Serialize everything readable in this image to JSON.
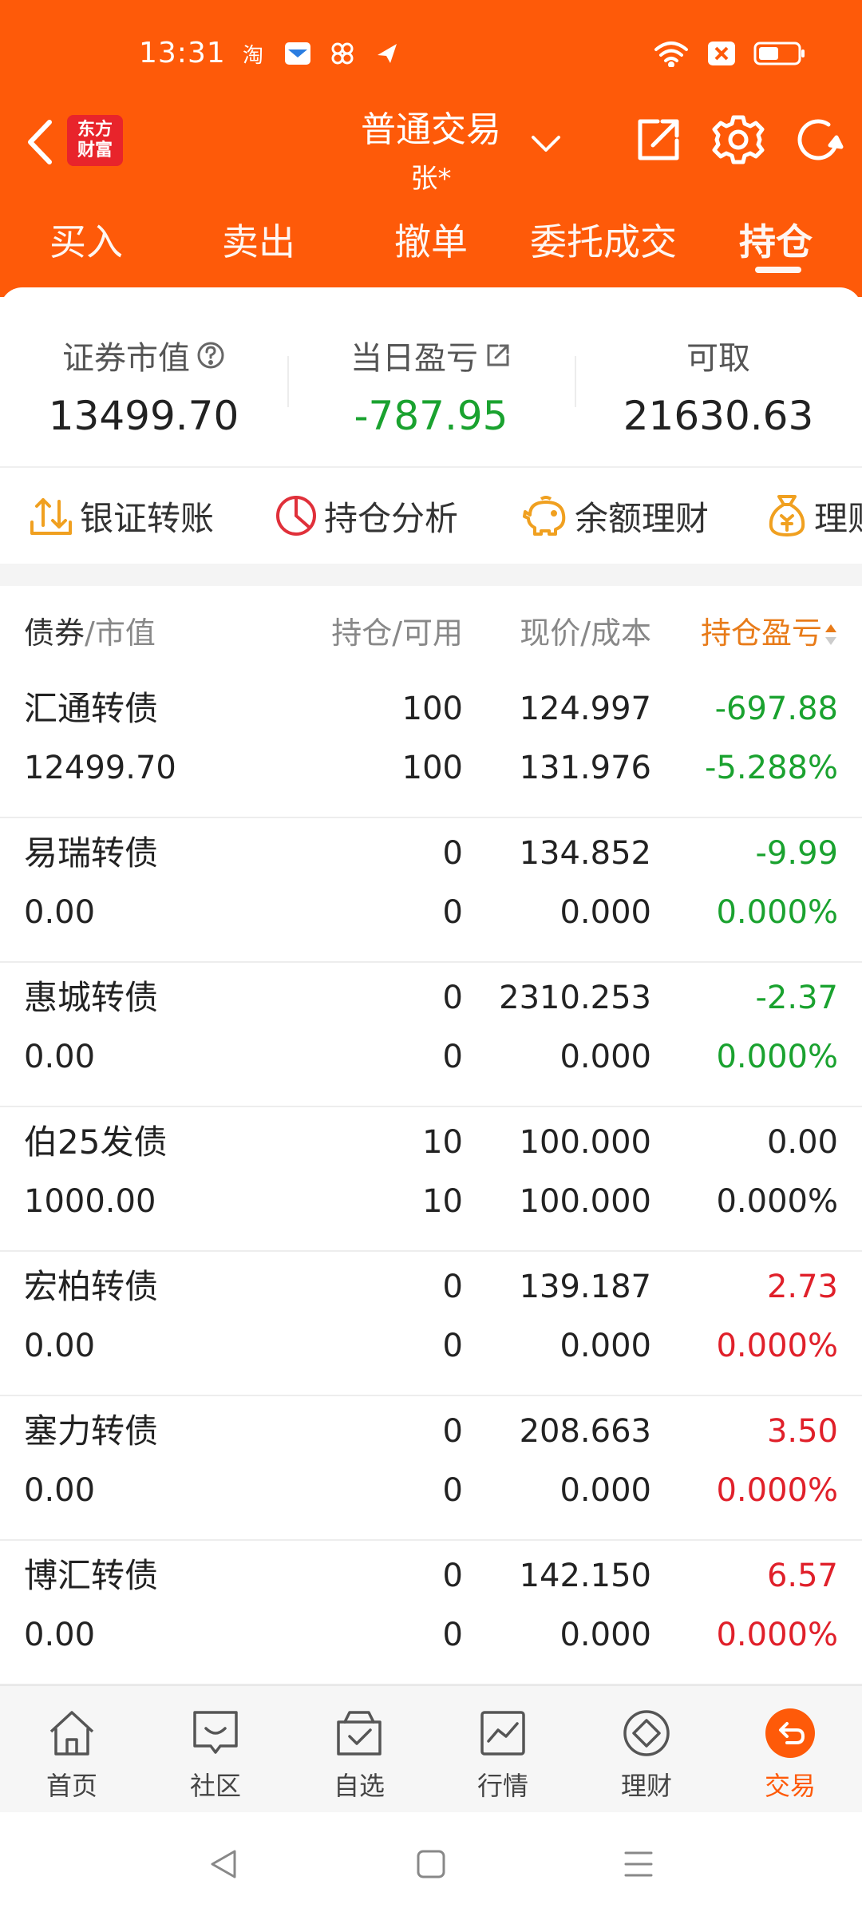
{
  "status_bar": {
    "time": "13:31",
    "app_glyph_1": "淘"
  },
  "header": {
    "logo_line1": "东方",
    "logo_line2": "财富",
    "title": "普通交易",
    "subtitle": "张*",
    "tabs": [
      {
        "label": "买入"
      },
      {
        "label": "卖出"
      },
      {
        "label": "撤单"
      },
      {
        "label": "委托成交"
      },
      {
        "label": "持仓"
      }
    ],
    "active_tab": "持仓"
  },
  "summary": {
    "market_value_label": "证券市值",
    "market_value": "13499.70",
    "daily_pnl_label": "当日盈亏",
    "daily_pnl": "-787.95",
    "withdrawable_label": "可取",
    "withdrawable": "21630.63"
  },
  "actions": [
    {
      "label": "银证转账",
      "icon": "transfer-icon"
    },
    {
      "label": "持仓分析",
      "icon": "pie-chart-icon"
    },
    {
      "label": "余额理财",
      "icon": "piggy-bank-icon"
    },
    {
      "label": "理财",
      "icon": "money-bag-icon"
    }
  ],
  "table": {
    "col_name": "债券",
    "col_name_sub": "/市值",
    "col_position": "持仓/可用",
    "col_price": "现价/成本",
    "col_pnl": "持仓盈亏",
    "rows": [
      {
        "name": "汇通转债",
        "value": "12499.70",
        "hold": "100",
        "avail": "100",
        "price": "124.997",
        "cost": "131.976",
        "pnl": "-697.88",
        "pnl_pct": "-5.288%",
        "c1": "#1aa22f",
        "c2": "#1aa22f"
      },
      {
        "name": "易瑞转债",
        "value": "0.00",
        "hold": "0",
        "avail": "0",
        "price": "134.852",
        "cost": "0.000",
        "pnl": "-9.99",
        "pnl_pct": "0.000%",
        "c1": "#1aa22f",
        "c2": "#1aa22f"
      },
      {
        "name": "惠城转债",
        "value": "0.00",
        "hold": "0",
        "avail": "0",
        "price": "2310.253",
        "cost": "0.000",
        "pnl": "-2.37",
        "pnl_pct": "0.000%",
        "c1": "#1aa22f",
        "c2": "#1aa22f"
      },
      {
        "name": "伯25发债",
        "value": "1000.00",
        "hold": "10",
        "avail": "10",
        "price": "100.000",
        "cost": "100.000",
        "pnl": "0.00",
        "pnl_pct": "0.000%",
        "c1": "#222222",
        "c2": "#222222"
      },
      {
        "name": "宏柏转债",
        "value": "0.00",
        "hold": "0",
        "avail": "0",
        "price": "139.187",
        "cost": "0.000",
        "pnl": "2.73",
        "pnl_pct": "0.000%",
        "c1": "#e0202a",
        "c2": "#e0202a"
      },
      {
        "name": "塞力转债",
        "value": "0.00",
        "hold": "0",
        "avail": "0",
        "price": "208.663",
        "cost": "0.000",
        "pnl": "3.50",
        "pnl_pct": "0.000%",
        "c1": "#e0202a",
        "c2": "#e0202a"
      },
      {
        "name": "博汇转债",
        "value": "0.00",
        "hold": "0",
        "avail": "0",
        "price": "142.150",
        "cost": "0.000",
        "pnl": "6.57",
        "pnl_pct": "0.000%",
        "c1": "#e0202a",
        "c2": "#e0202a"
      }
    ]
  },
  "bottom_nav": [
    {
      "label": "首页",
      "icon": "home-icon"
    },
    {
      "label": "社区",
      "icon": "community-icon"
    },
    {
      "label": "自选",
      "icon": "watchlist-icon"
    },
    {
      "label": "行情",
      "icon": "market-chart-icon"
    },
    {
      "label": "理财",
      "icon": "wealth-icon"
    },
    {
      "label": "交易",
      "icon": "trade-icon"
    }
  ],
  "active_bottom_nav": "交易",
  "colors": {
    "brand": "#fe5a09",
    "loss_green": "#1aa22f",
    "gain_red": "#e0202a",
    "sort_orange": "#e87b19"
  }
}
